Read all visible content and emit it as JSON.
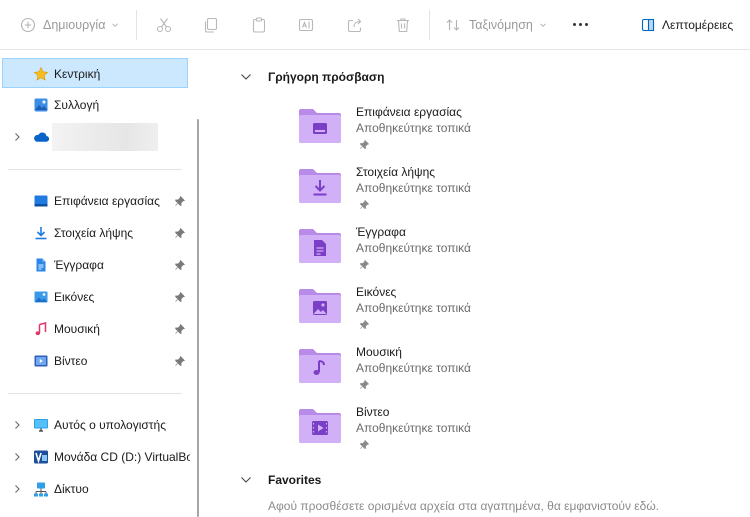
{
  "toolbar": {
    "new_label": "Δημιουργία",
    "sort_label": "Ταξινόμηση",
    "details_label": "Λεπτομέρειες"
  },
  "sidebar": {
    "home": "Κεντρική",
    "gallery": "Συλλογή",
    "pinned": [
      {
        "label": "Επιφάνεια εργασίας",
        "icon": "desktop-icon"
      },
      {
        "label": "Στοιχεία λήψης",
        "icon": "download-icon"
      },
      {
        "label": "Έγγραφα",
        "icon": "documents-icon"
      },
      {
        "label": "Εικόνες",
        "icon": "pictures-icon"
      },
      {
        "label": "Μουσική",
        "icon": "music-icon"
      },
      {
        "label": "Βίντεο",
        "icon": "video-icon"
      }
    ],
    "this_pc": "Αυτός ο υπολογιστής",
    "cd_drive": "Μονάδα CD (D:) VirtualBox",
    "network": "Δίκτυο"
  },
  "main": {
    "quick_access_title": "Γρήγορη πρόσβαση",
    "items": [
      {
        "name": "Επιφάνεια εργασίας",
        "sub": "Αποθηκεύτηκε τοπικά",
        "icon": "desktop-folder-icon"
      },
      {
        "name": "Στοιχεία λήψης",
        "sub": "Αποθηκεύτηκε τοπικά",
        "icon": "downloads-folder-icon"
      },
      {
        "name": "Έγγραφα",
        "sub": "Αποθηκεύτηκε τοπικά",
        "icon": "documents-folder-icon"
      },
      {
        "name": "Εικόνες",
        "sub": "Αποθηκεύτηκε τοπικά",
        "icon": "pictures-folder-icon"
      },
      {
        "name": "Μουσική",
        "sub": "Αποθηκεύτηκε τοπικά",
        "icon": "music-folder-icon"
      },
      {
        "name": "Βίντεο",
        "sub": "Αποθηκεύτηκε τοπικά",
        "icon": "videos-folder-icon"
      }
    ],
    "favorites_title": "Favorites",
    "favorites_empty": "Αφού προσθέσετε ορισμένα αρχεία στα αγαπημένα, θα εμφανιστούν εδώ."
  },
  "colors": {
    "accent": "#0067c0",
    "selection_bg": "#cce8ff",
    "selection_border": "#99d1ff",
    "folder_purple": "#c59cf0"
  }
}
